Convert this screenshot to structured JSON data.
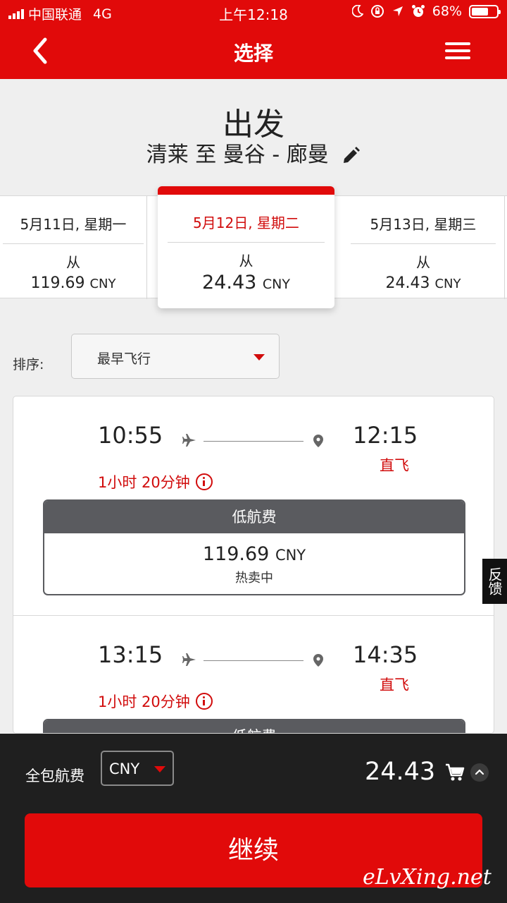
{
  "status_bar": {
    "carrier": "中国联通",
    "network": "4G",
    "time": "上午12:18",
    "battery": "68%",
    "battery_level": 0.68
  },
  "navbar": {
    "title": "选择",
    "back_icon": "chevron-left-icon",
    "menu_icon": "hamburger-menu-icon"
  },
  "header": {
    "title": "出发",
    "route": "清莱 至 曼谷 - 廊曼",
    "edit_icon": "pencil-icon"
  },
  "dates": [
    {
      "label": "5月11日, 星期一",
      "from": "从",
      "price": "119.69",
      "currency": "CNY",
      "selected": false
    },
    {
      "label": "5月12日, 星期二",
      "from": "从",
      "price": "24.43",
      "currency": "CNY",
      "selected": true
    },
    {
      "label": "5月13日, 星期三",
      "from": "从",
      "price": "24.43",
      "currency": "CNY",
      "selected": false
    }
  ],
  "sort": {
    "label": "排序:",
    "value": "最早飞行"
  },
  "flights": [
    {
      "depart": "10:55",
      "arrive": "12:15",
      "stops": "直飞",
      "duration": "1小时 20分钟",
      "fare_name": "低航费",
      "fare_amount": "119.69",
      "fare_currency": "CNY",
      "fare_note": "热卖中"
    },
    {
      "depart": "13:15",
      "arrive": "14:35",
      "stops": "直飞",
      "duration": "1小时 20分钟",
      "fare_name": "低航费",
      "fare_amount": "",
      "fare_currency": "",
      "fare_note": ""
    }
  ],
  "feedback": "反馈",
  "footer": {
    "total_label": "全包航费",
    "currency": "CNY",
    "total": "24.43",
    "continue": "继续",
    "watermark": "eLvXing.net"
  },
  "colors": {
    "brand_red": "#e10a0a",
    "text_red": "#d10c0c",
    "fare_header": "#5a5b5f",
    "footer_bg": "#1f1f1f"
  }
}
